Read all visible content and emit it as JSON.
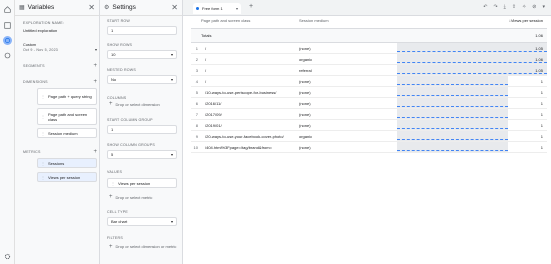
{
  "rail": {
    "icons": [
      "home-icon",
      "reports-icon",
      "explore-icon",
      "advertising-icon",
      "settings-icon"
    ]
  },
  "variables": {
    "title": "Variables",
    "exploration_name_label": "EXPLORATION NAME:",
    "exploration_name": "Untitled exploration",
    "date_label": "Custom",
    "date_range": "Oct 9 - Nov 5, 2023",
    "segments_label": "SEGMENTS",
    "dimensions_label": "DIMENSIONS",
    "dimensions": [
      "Page path + query string",
      "Page path and screen class",
      "Session medium"
    ],
    "metrics_label": "METRICS",
    "metrics": [
      "Sessions",
      "Views per session"
    ]
  },
  "settings": {
    "title": "Settings",
    "start_row_label": "START ROW",
    "start_row": "1",
    "show_rows_label": "SHOW ROWS",
    "show_rows": "10",
    "nested_rows_label": "NESTED ROWS",
    "nested_rows": "No",
    "columns_label": "COLUMNS",
    "columns_drop": "Drop or select dimension",
    "start_column_group_label": "START COLUMN GROUP",
    "start_column_group": "1",
    "show_column_groups_label": "SHOW COLUMN GROUPS",
    "show_column_groups": "5",
    "values_label": "VALUES",
    "value_chip": "Views per session",
    "values_drop": "Drop or select metric",
    "cell_type_label": "CELL TYPE",
    "cell_type": "Bar chart",
    "filters_label": "FILTERS",
    "filters_drop": "Drop or select dimension or metric"
  },
  "canvas": {
    "tab_name": "Free form 1",
    "columns": {
      "c1": "Page path and screen class",
      "c2": "Session medium",
      "c3": "↓Views per session"
    },
    "totals_label": "Totals",
    "totals_value": "1.06",
    "rows": [
      {
        "n": "1",
        "path": "/",
        "medium": "(none)",
        "value": "1.05",
        "fraction": 1.0
      },
      {
        "n": "2",
        "path": "/",
        "medium": "organic",
        "value": "1.06",
        "fraction": 1.0
      },
      {
        "n": "3",
        "path": "/",
        "medium": "referral",
        "value": "1.05",
        "fraction": 1.0
      },
      {
        "n": "4",
        "path": "/",
        "medium": "(none)",
        "value": "1",
        "fraction": 0.74
      },
      {
        "n": "5",
        "path": "/10-ways-to-use-periscope-for-business/",
        "medium": "(none)",
        "value": "1",
        "fraction": 0.74
      },
      {
        "n": "6",
        "path": "/2016/11/",
        "medium": "(none)",
        "value": "1",
        "fraction": 0.74
      },
      {
        "n": "7",
        "path": "/2017/09/",
        "medium": "(none)",
        "value": "1",
        "fraction": 0.74
      },
      {
        "n": "8",
        "path": "/2019/01/",
        "medium": "(none)",
        "value": "1",
        "fraction": 0.74
      },
      {
        "n": "9",
        "path": "/20-ways-to-use-your-facebook-cover-photo/",
        "medium": "organic",
        "value": "1",
        "fraction": 0.74
      },
      {
        "n": "10",
        "path": "/404.html%3Fpage=/tag/brand&from=",
        "medium": "(none)",
        "value": "1",
        "fraction": 0.74
      }
    ]
  }
}
